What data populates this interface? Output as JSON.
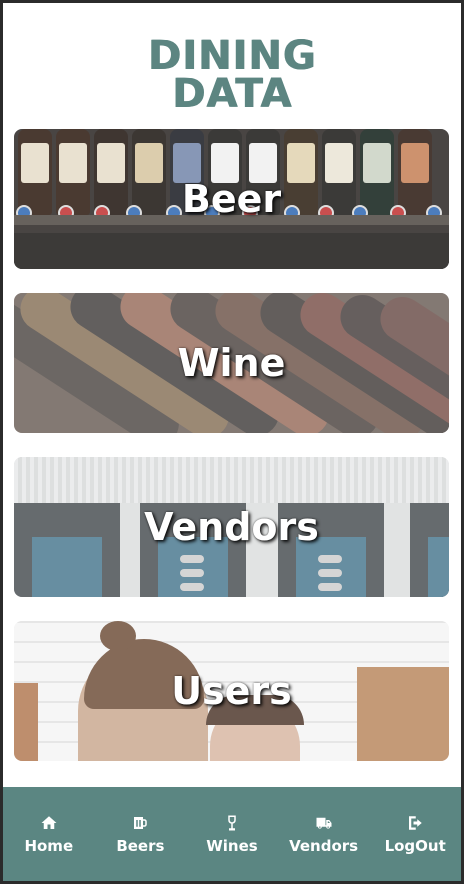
{
  "logo": {
    "line1": "DINING",
    "line2": "DATA"
  },
  "cards": [
    {
      "label": "Beer"
    },
    {
      "label": "Wine"
    },
    {
      "label": "Vendors"
    },
    {
      "label": "Users"
    }
  ],
  "nav": {
    "items": [
      {
        "label": "Home",
        "icon": "home-icon"
      },
      {
        "label": "Beers",
        "icon": "beer-mug-icon"
      },
      {
        "label": "Wines",
        "icon": "wine-glass-icon"
      },
      {
        "label": "Vendors",
        "icon": "truck-icon"
      },
      {
        "label": "LogOut",
        "icon": "logout-icon"
      }
    ]
  },
  "colors": {
    "accent": "#5b8682",
    "logo": "#5c8581",
    "card_text": "#ffffff"
  }
}
